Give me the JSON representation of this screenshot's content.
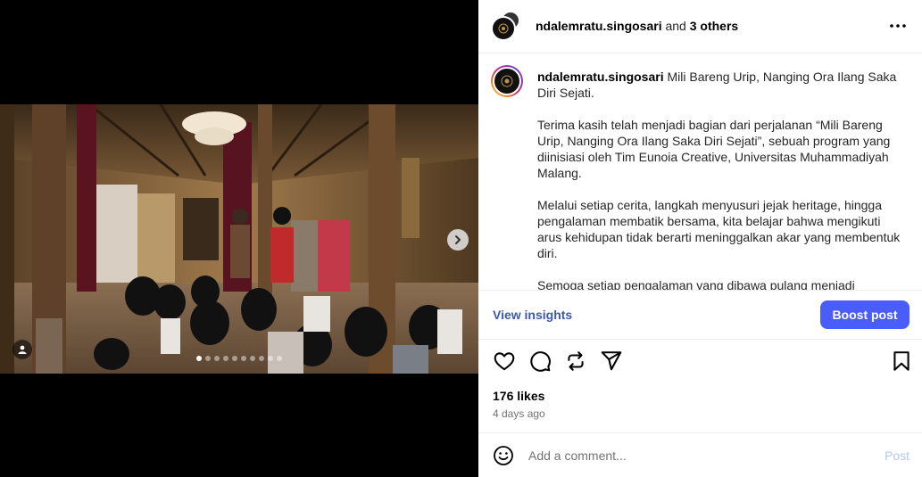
{
  "header": {
    "username": "ndalemratu.singosari",
    "and_text": "and",
    "others_text": "3 others"
  },
  "caption": {
    "username": "ndalemratu.singosari",
    "title": "Mili Bareng Urip, Nanging Ora Ilang Saka Diri Sejati.",
    "paragraphs": [
      "Terima kasih telah menjadi bagian dari perjalanan “Mili Bareng Urip, Nanging Ora Ilang Saka Diri Sejati”, sebuah program yang diinisiasi oleh Tim Eunoia Creative, Universitas Muhammadiyah Malang.",
      "Melalui setiap cerita, langkah menyusuri jejak heritage, hingga pengalaman membatik bersama, kita belajar bahwa mengikuti arus kehidupan tidak berarti meninggalkan akar yang membentuk diri.",
      "Semoga setiap pengalaman yang dibawa pulang menjadi"
    ]
  },
  "insights": {
    "view_label": "View insights",
    "boost_label": "Boost post"
  },
  "engagement": {
    "likes": "176 likes",
    "posted": "4 days ago"
  },
  "comment": {
    "placeholder": "Add a comment...",
    "post_label": "Post"
  },
  "carousel": {
    "total": 10,
    "current": 1
  },
  "icons": {
    "like": "heart-icon",
    "comment": "comment-icon",
    "repost": "repost-icon",
    "share": "send-icon",
    "save": "bookmark-icon",
    "more": "more-horizontal-icon",
    "next": "chevron-right-icon",
    "tag": "user-tag-icon",
    "emoji": "emoji-icon"
  },
  "colors": {
    "boost_bg": "#4a5df9",
    "insights_link": "#3d5aa8",
    "post_disabled": "#b3c8f5"
  }
}
